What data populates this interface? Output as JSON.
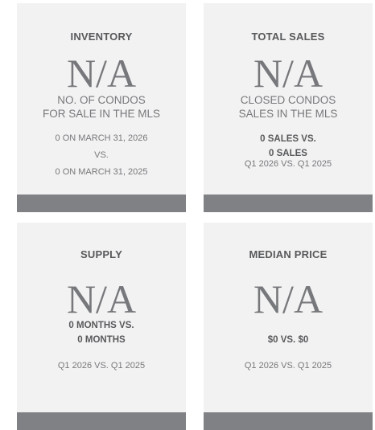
{
  "cards": {
    "inventory": {
      "title": "INVENTORY",
      "value": "N/A",
      "desc_line1": "NO. OF CONDOS",
      "desc_line2": "FOR SALE IN THE MLS",
      "cmp_line1": "0 ON MARCH 31, 2026",
      "cmp_line2": "VS.",
      "cmp_line3": "0 ON MARCH 31, 2025"
    },
    "total_sales": {
      "title": "TOTAL SALES",
      "value": "N/A",
      "desc_line1": "CLOSED CONDOS",
      "desc_line2": "SALES IN THE MLS",
      "cmp_line1": "0 SALES VS.",
      "cmp_line2": "0 SALES",
      "period": "Q1 2026 VS. Q1 2025"
    },
    "supply": {
      "title": "SUPPLY",
      "value": "N/A",
      "cmp_line1": "0 MONTHS VS.",
      "cmp_line2": "0 MONTHS",
      "period": "Q1 2026 VS. Q1 2025"
    },
    "median_price": {
      "title": "MEDIAN PRICE",
      "value": "N/A",
      "cmp_line1": "$0 VS. $0",
      "period": "Q1 2026 VS. Q1 2025"
    }
  },
  "colors": {
    "card_bg": "#f2f2f3",
    "footer_bar": "#808184",
    "text": "#77787b"
  }
}
